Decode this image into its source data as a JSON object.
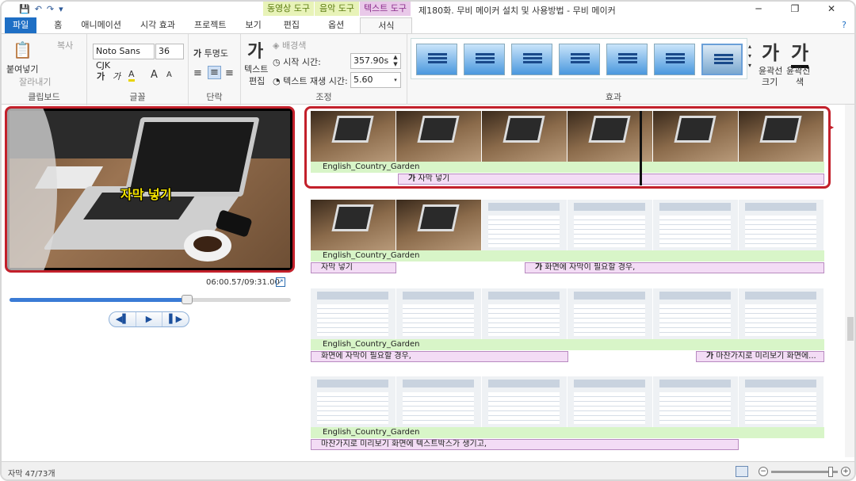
{
  "window": {
    "title": "제180화. 무비 메이커 설치 및 사용방법 - 무비 메이커",
    "minimize": "─",
    "restore": "❐",
    "close": "✕"
  },
  "quick_access": {
    "save": "💾",
    "undo": "↶",
    "redo": "↷",
    "more": "▾"
  },
  "context_tabs": {
    "video_tools": "동영상 도구",
    "music_tools": "음악 도구",
    "text_tools": "텍스트 도구"
  },
  "tabs": [
    {
      "label": "파일"
    },
    {
      "label": "홈"
    },
    {
      "label": "애니메이션"
    },
    {
      "label": "시각 효과"
    },
    {
      "label": "프로젝트"
    },
    {
      "label": "보기"
    },
    {
      "label": "편집"
    },
    {
      "label": "옵션"
    },
    {
      "label": "서식"
    }
  ],
  "help_icon": "?",
  "ribbon": {
    "clipboard": {
      "label": "클립보드",
      "paste": "붙여넣기",
      "copy": "복사",
      "cut": "잘라내기"
    },
    "font": {
      "label": "글꼴",
      "font_name": "Noto Sans CJK",
      "font_size": "36",
      "bold": "가",
      "italic": "가",
      "color": "A",
      "grow": "A",
      "shrink": "A"
    },
    "paragraph": {
      "label": "단락",
      "transparency": "투명도"
    },
    "adjust": {
      "label": "조정",
      "text_edit_line1": "텍스트",
      "text_edit_line2": "편집",
      "background_color": "배경색",
      "start_time_label": "시작 시간:",
      "start_time_value": "357.90s",
      "duration_label": "텍스트 재생 시간:",
      "duration_value": "5.60"
    },
    "effects": {
      "label": "효과",
      "outline_size_line1": "윤곽선",
      "outline_size_line2": "크기",
      "outline_color_line1": "윤곽선",
      "outline_color_line2": "색",
      "glyph": "가"
    }
  },
  "preview": {
    "caption": "자막 넣기",
    "timecode": "06:00.57/09:31.00",
    "progress": 0.63,
    "controls": {
      "prev": "◀▌",
      "play": "▶",
      "next": "▌▶"
    }
  },
  "storyboard": {
    "rows": [
      {
        "audio": "English_Country_Garden",
        "captions": [
          {
            "text": "자막 넣기",
            "icon": true
          }
        ]
      },
      {
        "audio": "English_Country_Garden",
        "captions": [
          {
            "text": "자막 넣기",
            "icon": false
          },
          {
            "text": "화면에 자막이 필요할 경우,",
            "icon": true
          }
        ]
      },
      {
        "audio": "English_Country_Garden",
        "captions": [
          {
            "text": "화면에 자막이 필요할 경우,",
            "icon": false
          },
          {
            "text": "마찬가지로 미리보기 화면에...",
            "icon": true
          }
        ]
      },
      {
        "audio": "English_Country_Garden",
        "captions": [
          {
            "text": "마찬가지로 미리보기 화면에 텍스트박스가 생기고,",
            "icon": false
          }
        ]
      }
    ],
    "caption_icon": "가"
  },
  "status": {
    "caption_count": "자막 47/73개",
    "zoom_out": "−",
    "zoom_in": "+"
  }
}
